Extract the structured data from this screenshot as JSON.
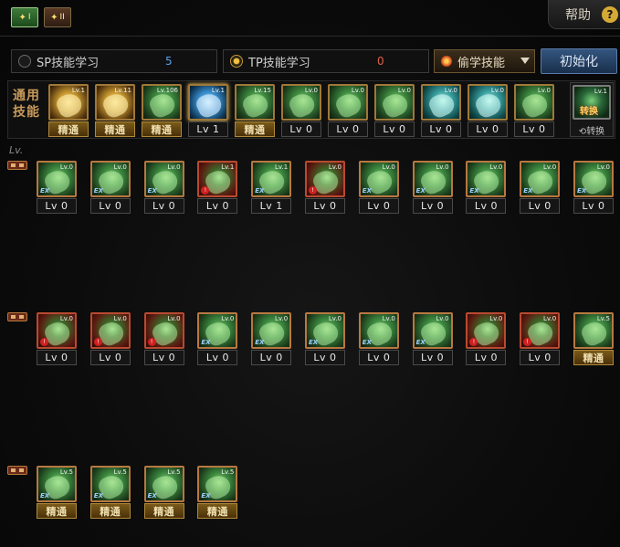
{
  "tabs": [
    {
      "label": "I"
    },
    {
      "label": "II"
    }
  ],
  "help": {
    "label": "帮助",
    "icon": "?"
  },
  "sp": {
    "label": "SP技能学习",
    "value": "5"
  },
  "tp": {
    "label": "TP技能学习",
    "value": "0"
  },
  "steal": {
    "label": "偷学技能"
  },
  "init": {
    "label": "初始化"
  },
  "general": {
    "label": "通用技能",
    "skills": [
      {
        "lv": "Lv.1",
        "footer": "精通",
        "mastered": true,
        "color": "gold"
      },
      {
        "lv": "Lv.11",
        "footer": "精通",
        "mastered": true,
        "color": "gold"
      },
      {
        "lv": "Lv.106",
        "footer": "精通",
        "mastered": true,
        "color": "green"
      },
      {
        "lv": "Lv.1",
        "footer": "Lv 1",
        "mastered": false,
        "color": "blue",
        "selected": true
      },
      {
        "lv": "Lv.15",
        "footer": "精通",
        "mastered": true,
        "color": "green"
      },
      {
        "lv": "Lv.0",
        "footer": "Lv 0",
        "mastered": false,
        "color": "green"
      },
      {
        "lv": "Lv.0",
        "footer": "Lv 0",
        "mastered": false,
        "color": "green"
      },
      {
        "lv": "Lv.0",
        "footer": "Lv 0",
        "mastered": false,
        "color": "green"
      },
      {
        "lv": "Lv.0",
        "footer": "Lv 0",
        "mastered": false,
        "color": "teal"
      },
      {
        "lv": "Lv.0",
        "footer": "Lv 0",
        "mastered": false,
        "color": "teal"
      },
      {
        "lv": "Lv.0",
        "footer": "Lv 0",
        "mastered": false,
        "color": "green"
      }
    ],
    "swap": {
      "lv": "Lv.1",
      "label": "转换",
      "mark": "转换"
    }
  },
  "lv_mark": "Lv.",
  "rows": [
    {
      "skills": [
        {
          "lv": "Lv.0",
          "footer": "Lv 0",
          "badge": "ex",
          "color": "green"
        },
        {
          "lv": "Lv.0",
          "footer": "Lv 0",
          "badge": "ex",
          "color": "green"
        },
        {
          "lv": "Lv.0",
          "footer": "Lv 0",
          "badge": "ex",
          "color": "green"
        },
        {
          "lv": "Lv.1",
          "footer": "Lv 0",
          "badge": "red",
          "color": "red"
        },
        {
          "lv": "Lv.1",
          "footer": "Lv 1",
          "badge": "ex",
          "color": "green"
        },
        {
          "lv": "Lv.0",
          "footer": "Lv 0",
          "badge": "red",
          "color": "red"
        },
        {
          "lv": "Lv.0",
          "footer": "Lv 0",
          "badge": "ex",
          "color": "green"
        },
        {
          "lv": "Lv.0",
          "footer": "Lv 0",
          "badge": "ex",
          "color": "green"
        },
        {
          "lv": "Lv.0",
          "footer": "Lv 0",
          "badge": "ex",
          "color": "green"
        },
        {
          "lv": "Lv.0",
          "footer": "Lv 0",
          "badge": "ex",
          "color": "green"
        },
        {
          "lv": "Lv.0",
          "footer": "Lv 0",
          "badge": "ex",
          "color": "green"
        }
      ]
    },
    {
      "skills": [
        {
          "lv": "Lv.0",
          "footer": "Lv 0",
          "badge": "red",
          "color": "red"
        },
        {
          "lv": "Lv.0",
          "footer": "Lv 0",
          "badge": "red",
          "color": "red"
        },
        {
          "lv": "Lv.0",
          "footer": "Lv 0",
          "badge": "red",
          "color": "red"
        },
        {
          "lv": "Lv.0",
          "footer": "Lv 0",
          "badge": "ex",
          "color": "green"
        },
        {
          "lv": "Lv.0",
          "footer": "Lv 0",
          "badge": "ex",
          "color": "green"
        },
        {
          "lv": "Lv.0",
          "footer": "Lv 0",
          "badge": "ex",
          "color": "green"
        },
        {
          "lv": "Lv.0",
          "footer": "Lv 0",
          "badge": "ex",
          "color": "green"
        },
        {
          "lv": "Lv.0",
          "footer": "Lv 0",
          "badge": "ex",
          "color": "green"
        },
        {
          "lv": "Lv.0",
          "footer": "Lv 0",
          "badge": "red",
          "color": "red"
        },
        {
          "lv": "Lv.0",
          "footer": "Lv 0",
          "badge": "red",
          "color": "red"
        },
        {
          "lv": "Lv.5",
          "footer": "精通",
          "badge": "",
          "color": "green",
          "mastered": true
        }
      ]
    },
    {
      "skills": [
        {
          "lv": "Lv.5",
          "footer": "精通",
          "badge": "ex",
          "color": "green",
          "mastered": true
        },
        {
          "lv": "Lv.5",
          "footer": "精通",
          "badge": "ex",
          "color": "green",
          "mastered": true
        },
        {
          "lv": "Lv.5",
          "footer": "精通",
          "badge": "ex",
          "color": "green",
          "mastered": true
        },
        {
          "lv": "Lv.5",
          "footer": "精通",
          "badge": "ex",
          "color": "green",
          "mastered": true
        }
      ]
    }
  ]
}
